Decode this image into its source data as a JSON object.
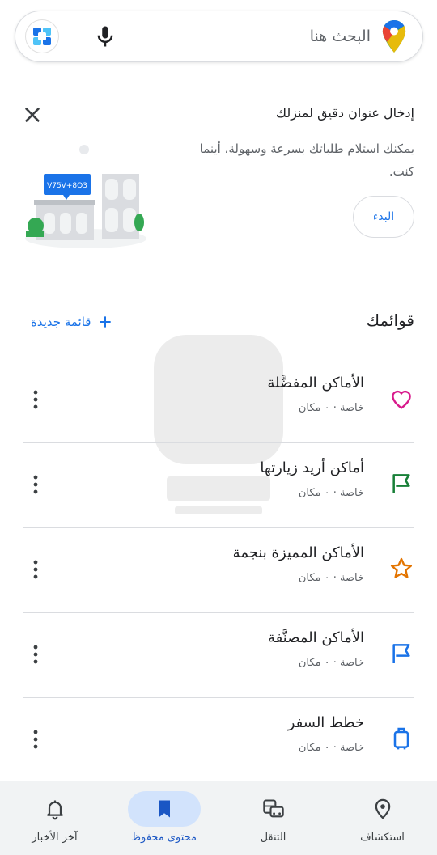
{
  "search": {
    "placeholder": "البحث هنا"
  },
  "address_card": {
    "title": "إدخال عنوان دقيق لمنزلك",
    "description": "يمكنك استلام طلباتك بسرعة وسهولة، أينما كنت.",
    "start_label": "البدء",
    "plus_code": "V75V+8Q3"
  },
  "lists": {
    "title": "قوائمك",
    "new_list_label": "قائمة جديدة",
    "items": [
      {
        "title": "الأماكن المفضَّلة",
        "subtitle": "خاصة · ٠ مكان",
        "icon": "heart-icon",
        "color": "#d81b8c"
      },
      {
        "title": "أماكن أريد زيارتها",
        "subtitle": "خاصة · ٠ مكان",
        "icon": "flag-icon",
        "color": "#188038"
      },
      {
        "title": "الأماكن المميزة بنجمة",
        "subtitle": "خاصة · ٠ مكان",
        "icon": "star-icon",
        "color": "#e37400"
      },
      {
        "title": "الأماكن المصنَّفة",
        "subtitle": "خاصة · ٠ مكان",
        "icon": "label-flag-icon",
        "color": "#1a73e8"
      },
      {
        "title": "خطط السفر",
        "subtitle": "خاصة · ٠ مكان",
        "icon": "luggage-icon",
        "color": "#1a73e8"
      }
    ]
  },
  "bottom_nav": {
    "items": [
      {
        "label": "آخر الأخبار",
        "icon": "bell-icon"
      },
      {
        "label": "محتوى محفوظ",
        "icon": "bookmark-icon",
        "active": true
      },
      {
        "label": "التنقل",
        "icon": "commute-icon"
      },
      {
        "label": "استكشاف",
        "icon": "location-pin-icon"
      }
    ]
  }
}
